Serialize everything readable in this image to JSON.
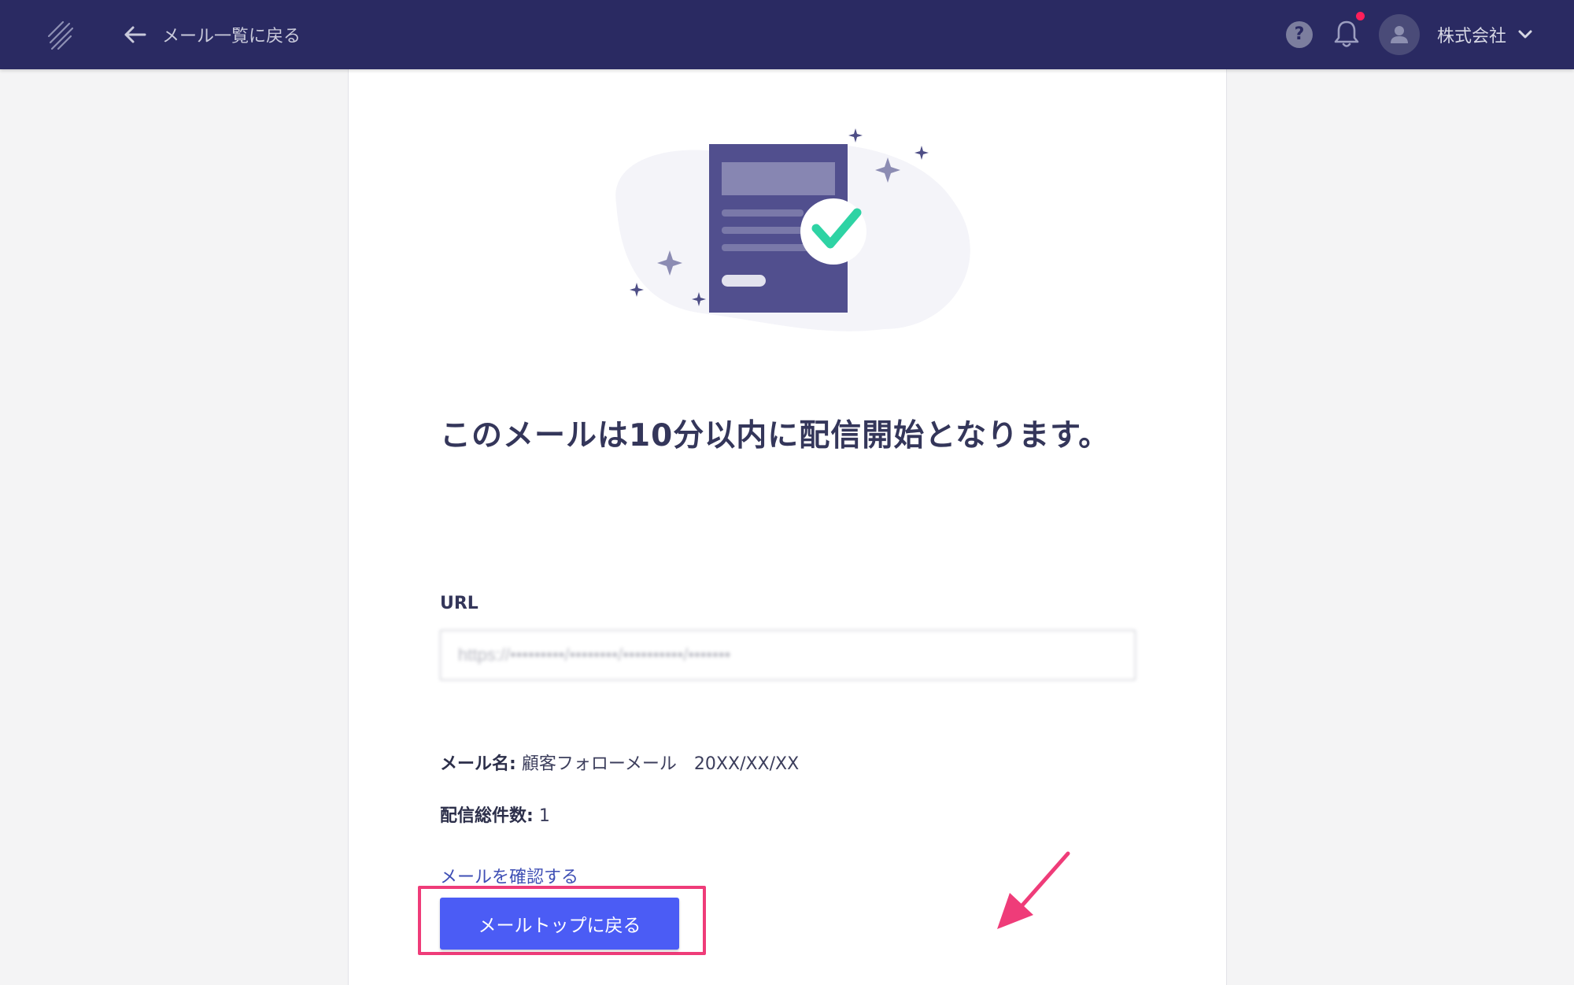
{
  "header": {
    "back_label": "メール一覧に戻る",
    "company_name": "株式会社",
    "help_glyph": "?",
    "colors": {
      "background": "#2a2a62",
      "notification_dot": "#ff1f5a"
    }
  },
  "main": {
    "headline": "このメールは10分以内に配信開始となります。",
    "url_label": "URL",
    "url_value": "https://•••••••••/••••••••/••••••••••/•••••••",
    "mail_name_label": "メール名:",
    "mail_name_value": "顧客フォローメール　20XX/XX/XX",
    "delivery_count_label": "配信総件数:",
    "delivery_count_value": "1",
    "view_mail_link": "メールを確認する",
    "primary_button": "メールトップに戻る",
    "colors": {
      "primary": "#4b5cf5",
      "link": "#3f4fb5",
      "annotation": "#ef3c79",
      "check": "#2ed3a4"
    }
  }
}
